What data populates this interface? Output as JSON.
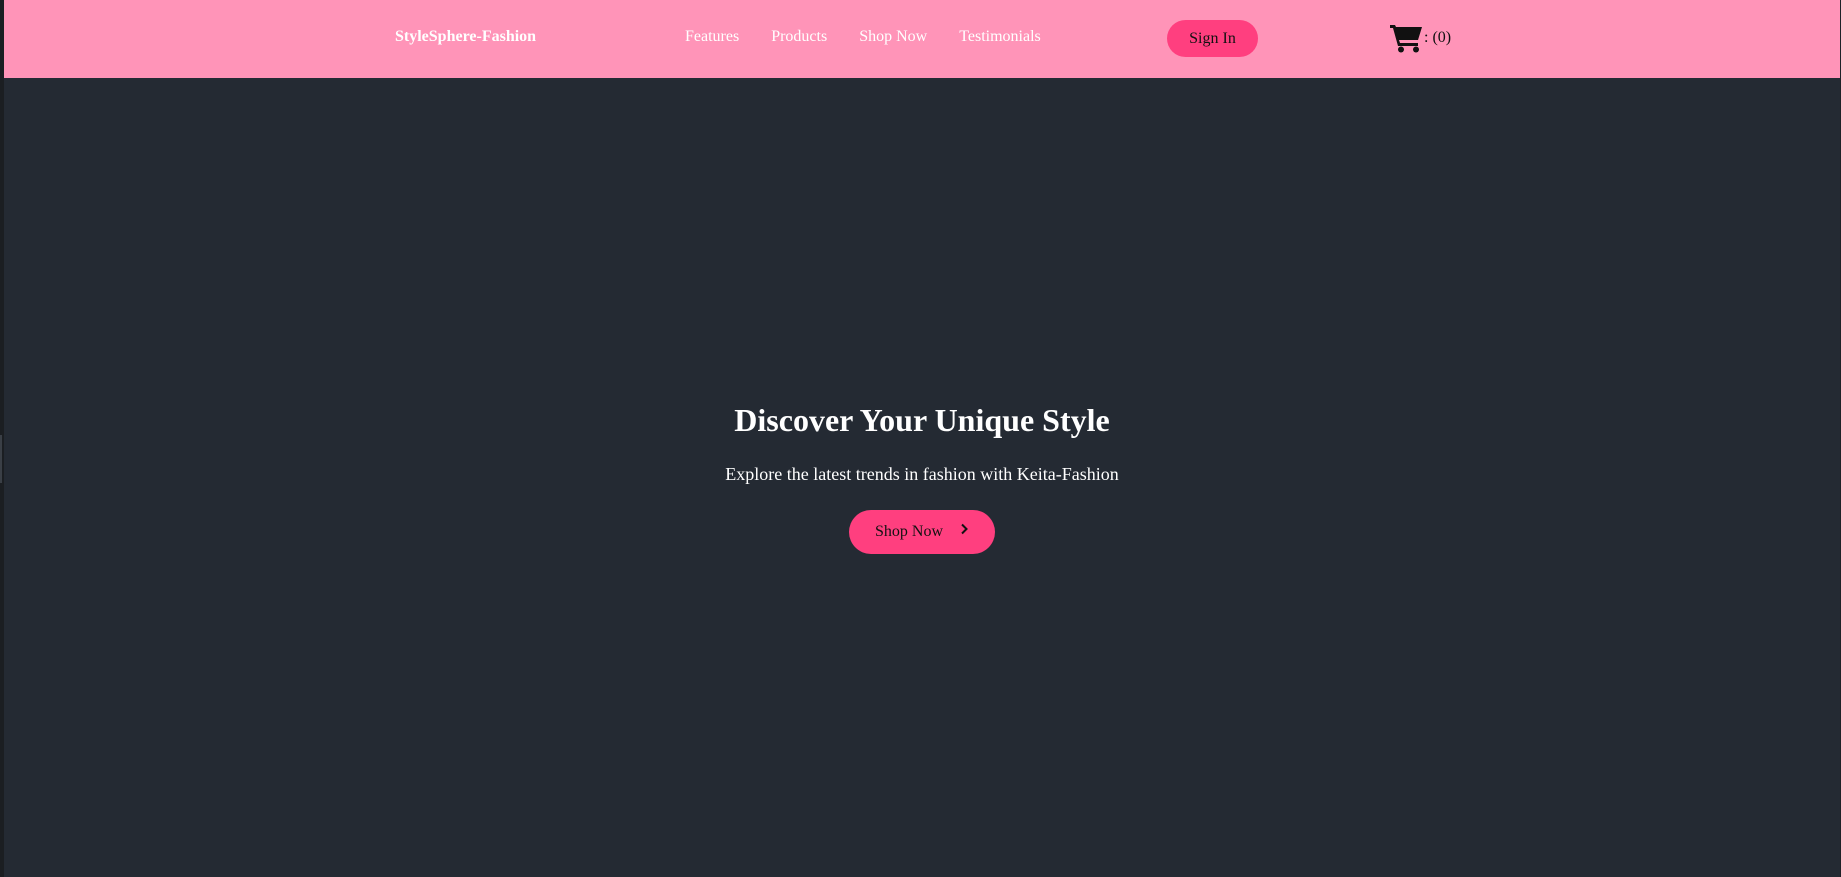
{
  "navbar": {
    "brand": "StyleSphere-Fashion",
    "links": [
      "Features",
      "Products",
      "Shop Now",
      "Testimonials"
    ],
    "signin_label": "Sign In",
    "cart_count_label": ": (0)",
    "cart_icon": "shopping-cart-icon"
  },
  "hero": {
    "title": "Discover Your Unique Style",
    "subtitle": "Explore the latest trends in fashion with Keita-Fashion",
    "cta_label": "Shop Now",
    "cta_icon": "chevron-right-icon"
  },
  "colors": {
    "navbar_bg": "#ff94b8",
    "accent": "#ff3f7f",
    "hero_bg": "#242a33",
    "text_light": "#ffffff"
  }
}
